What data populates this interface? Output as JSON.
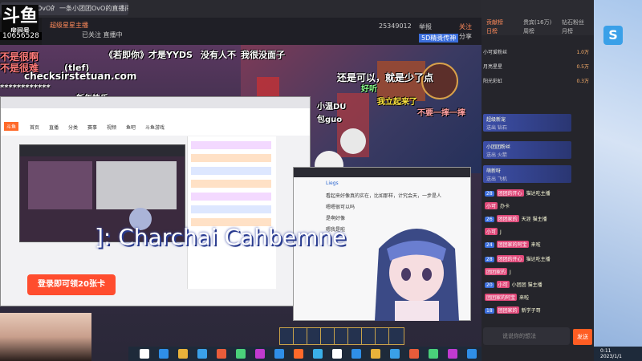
{
  "app": {
    "logo_text": "斗鱼",
    "logo_sub": "房间号",
    "room_id": "10656528"
  },
  "browser_tabs": [
    {
      "label": "一条小团团OvO的直播..."
    },
    {
      "label": "一条小团团OvO的直播间"
    }
  ],
  "stream_header": {
    "title_tag": "超级星星主播",
    "room_info": "已关注 直播中",
    "follow_label": "关注",
    "share_label": "分享",
    "viewer_count": "25349012",
    "report": "举报",
    "badge_label": "5D精贵传神"
  },
  "danmaku": [
    {
      "text": "《若即你》才是YYDS",
      "color": "#ffffff"
    },
    {
      "text": "没有人不",
      "color": "#ffffff"
    },
    {
      "text": "我很没面子",
      "color": "#ffffff"
    },
    {
      "text": "还是可以，就是少了点",
      "color": "#ffffff"
    },
    {
      "text": "好听",
      "color": "#8cff8c"
    },
    {
      "text": "我立起来了",
      "color": "#ffe640"
    },
    {
      "text": "新年快乐",
      "color": "#ffffff"
    },
    {
      "text": "小温DU",
      "color": "#ffffff"
    },
    {
      "text": "包guo",
      "color": "#ffffff"
    },
    {
      "text": "不要一摔一摔",
      "color": "#ffa0a0"
    },
    {
      "text": "不是很啊",
      "color": "#ff7a7a"
    },
    {
      "text": "checksirstetuan.com",
      "color": "#ffffff"
    },
    {
      "text": "不是很难",
      "color": "#ff7a7a"
    },
    {
      "text": "(tlef)",
      "color": "#ffffff"
    }
  ],
  "subtitle": "]: Charchai Cahbemne",
  "share_window": {
    "site_nav": [
      "首页",
      "直播",
      "分类",
      "赛事",
      "视频",
      "鱼吧",
      "斗鱼游戏"
    ],
    "promo": "登录即可领20张卡"
  },
  "chat_window2": {
    "lines": [
      "Liegs",
      "看起来好像真的实在，比如那样，计究会天，一步是人",
      "嗯嗯很可以吗",
      "是啊好像",
      "嗯我是啦"
    ]
  },
  "hotbar": {
    "count": 9
  },
  "taskbar": {
    "icon_count": 20
  },
  "sidebar": {
    "top_tabs": [
      "贡献榜",
      "贵宾(16万)",
      "钻石粉丝"
    ],
    "sub_tabs": [
      "日榜",
      "周榜",
      "月榜"
    ],
    "rank_list": [
      {
        "name": "小可爱粉丝",
        "value": "1.0万"
      },
      {
        "name": "月亮星星",
        "value": "0.5万"
      },
      {
        "name": "阳光彩虹",
        "value": "0.3万"
      }
    ],
    "gift_messages": [
      {
        "user": "超级新宠",
        "text": "送出 钻石"
      },
      {
        "user": "小团团粉丝",
        "text": "送出 火箭"
      },
      {
        "user": "萌新呀",
        "text": "送出 飞机"
      }
    ],
    "chat_messages": [
      {
        "user": "团团的开心",
        "text": "猫达吃主播"
      },
      {
        "user": "小可",
        "text": "办卡"
      },
      {
        "user": "团团家的",
        "text": "天涯 猫主播"
      },
      {
        "user": "小可",
        "text": "J"
      },
      {
        "user": "团团家的阿宝",
        "text": "来啦"
      },
      {
        "user": "团团的开心",
        "text": "猫达吃主播"
      },
      {
        "user": "团团家的",
        "text": "J"
      },
      {
        "user": "小可",
        "text": "小团团 猫主播"
      },
      {
        "user": "团团家的阿宝",
        "text": "来啦"
      },
      {
        "user": "团团家的",
        "text": "新学子哥"
      }
    ],
    "input_placeholder": "说说你的想法",
    "send_label": "发送"
  },
  "desktop": {
    "clock_time": "0:11",
    "clock_date": "2023/1/1"
  },
  "colors": {
    "accent": "#ff5d23",
    "sidebar_bg": "#25252b",
    "taskbar_bg": "#1e2a3a"
  }
}
